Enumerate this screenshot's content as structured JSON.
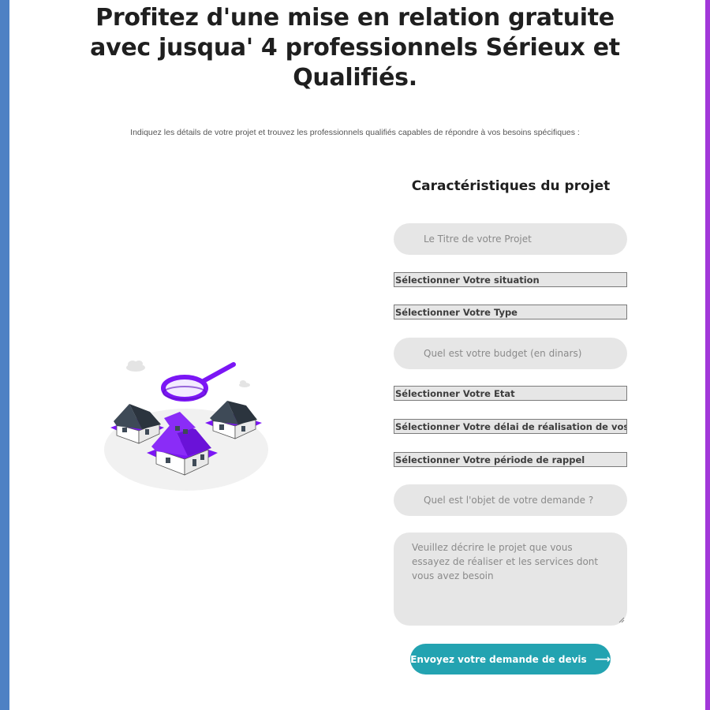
{
  "header": {
    "title": "Profitez d'une mise en relation gratuite avec jusqua' 4 professionnels Sérieux et Qualifiés.",
    "subtitle": "Indiquez les détails de votre projet et trouvez les professionnels qualifiés capables de répondre à vos besoins spécifiques :"
  },
  "form": {
    "title": "Caractéristiques du projet",
    "title_placeholder": "Le Titre de votre Projet",
    "situation_select": "Sélectionner Votre situation",
    "type_select": "Sélectionner Votre Type",
    "budget_placeholder": "Quel est votre budget (en dinars)",
    "etat_select": "Sélectionner Votre Etat",
    "delai_select": "Sélectionner Votre délai de réalisation de vos travaux",
    "rappel_select": "Sélectionner Votre période de rappel",
    "objet_placeholder": "Quel est l'objet de votre demande ?",
    "description_placeholder": "Veuillez décrire le projet que vous essayez de réaliser et les services dont vous avez besoin",
    "submit_label": "Envoyez votre demande de devis",
    "submit_icon": "arrow-right-icon"
  },
  "colors": {
    "left_edge": "#4e81c4",
    "right_edge": "#a238d9",
    "accent_purple": "#7b16f5",
    "button_teal": "#23a3b1",
    "field_bg": "#e6e6e6"
  }
}
